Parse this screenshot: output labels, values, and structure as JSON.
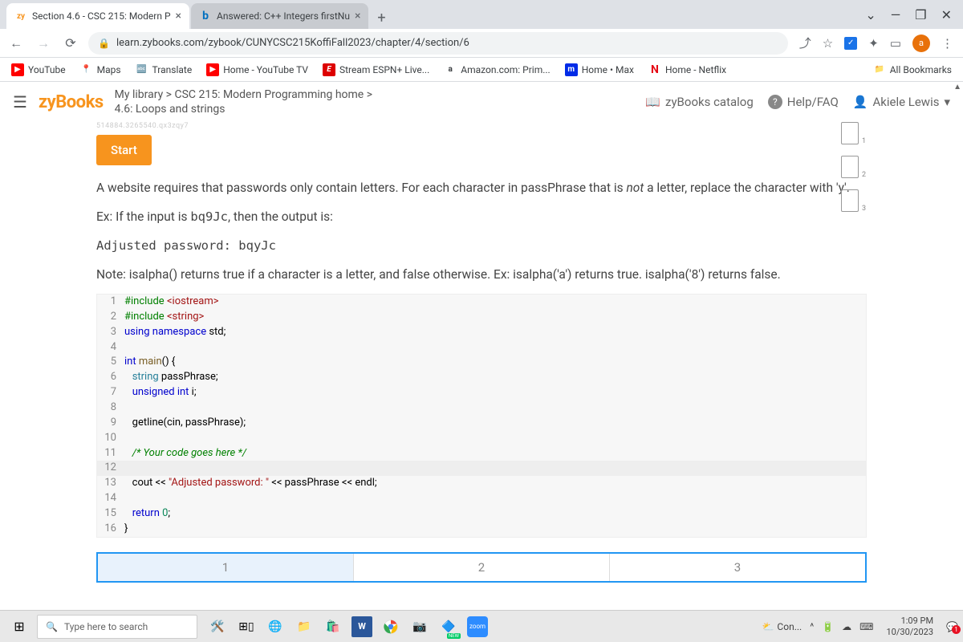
{
  "browser": {
    "tabs": [
      {
        "favicon_text": "zy",
        "favicon_color": "#f7941e",
        "title": "Section 4.6 - CSC 215: Modern P",
        "active": true
      },
      {
        "favicon_text": "b",
        "favicon_color": "#0070c0",
        "title": "Answered: C++ Integers firstNu",
        "active": false
      }
    ],
    "url": "learn.zybooks.com/zybook/CUNYCSC215KoffiFall2023/chapter/4/section/6",
    "bookmarks": [
      {
        "label": "YouTube",
        "icon": "▶",
        "icon_bg": "#ff0000",
        "icon_fg": "#fff"
      },
      {
        "label": "Maps",
        "icon": "📍",
        "icon_bg": "",
        "icon_fg": ""
      },
      {
        "label": "Translate",
        "icon": "🔤",
        "icon_bg": "",
        "icon_fg": ""
      },
      {
        "label": "Home - YouTube TV",
        "icon": "▶",
        "icon_bg": "#ff0000",
        "icon_fg": "#fff"
      },
      {
        "label": "Stream ESPN+ Live...",
        "icon": "E",
        "icon_bg": "#d00",
        "icon_fg": "#fff"
      },
      {
        "label": "Amazon.com: Prim...",
        "icon": "a",
        "icon_bg": "",
        "icon_fg": "#000"
      },
      {
        "label": "Home • Max",
        "icon": "m",
        "icon_bg": "#002be7",
        "icon_fg": "#fff"
      },
      {
        "label": "Home - Netflix",
        "icon": "N",
        "icon_bg": "",
        "icon_fg": "#e50914"
      }
    ],
    "all_bookmarks_label": "All Bookmarks",
    "avatar_letter": "a"
  },
  "zy": {
    "logo": "zyBooks",
    "breadcrumb_top": "My library > CSC 215: Modern Programming home >",
    "breadcrumb_bottom": "4.6: Loops and strings",
    "catalog": "zyBooks catalog",
    "help": "Help/FAQ",
    "user": "Akiele Lewis"
  },
  "activity": {
    "watermark": "514884.3265540.qx3zqy7",
    "start": "Start",
    "para1_a": "A website requires that passwords only contain letters. For each character in passPhrase that is ",
    "para1_em": "not",
    "para1_b": " a letter, replace the character with 'y'.",
    "ex_label": "Ex: If the input is ",
    "ex_input": "bq9Jc",
    "ex_tail": ", then the output is:",
    "ex_output": "Adjusted password: bqyJc",
    "note": "Note: isalpha() returns true if a character is a letter, and false otherwise. Ex: isalpha('a') returns true. isalpha('8') returns false.",
    "steps": [
      "1",
      "2",
      "3"
    ],
    "notebox_nums": [
      "1",
      "2",
      "3"
    ]
  },
  "code_lines": [
    {
      "n": 1,
      "html": "<span class='kw-green'>#include</span> <span class='kw-str'>&lt;iostream&gt;</span>"
    },
    {
      "n": 2,
      "html": "<span class='kw-green'>#include</span> <span class='kw-str'>&lt;string&gt;</span>"
    },
    {
      "n": 3,
      "html": "<span class='kw-blue'>using</span> <span class='kw-blue'>namespace</span> std;"
    },
    {
      "n": 4,
      "html": ""
    },
    {
      "n": 5,
      "html": "<span class='kw-blue'>int</span> <span class='kw-purple'>main</span>() {"
    },
    {
      "n": 6,
      "html": "   <span class='kw-teal'>string</span> passPhrase;"
    },
    {
      "n": 7,
      "html": "   <span class='kw-blue'>unsigned</span> <span class='kw-blue'>int</span> i;"
    },
    {
      "n": 8,
      "html": ""
    },
    {
      "n": 9,
      "html": "   getline(cin, passPhrase);"
    },
    {
      "n": 10,
      "html": ""
    },
    {
      "n": 11,
      "html": "   <span class='kw-comment'>/* Your code goes here */</span>"
    },
    {
      "n": 12,
      "html": "",
      "hl": true
    },
    {
      "n": 13,
      "html": "   cout &lt;&lt; <span class='kw-str'>\"Adjusted password: \"</span> &lt;&lt; passPhrase &lt;&lt; endl;"
    },
    {
      "n": 14,
      "html": ""
    },
    {
      "n": 15,
      "html": "   <span class='kw-blue'>return</span> <span class='kw-num'>0</span>;"
    },
    {
      "n": 16,
      "html": "}"
    }
  ],
  "taskbar": {
    "search_placeholder": "Type here to search",
    "weather_label": "Con...",
    "time": "1:09 PM",
    "date": "10/30/2023",
    "notif_count": "1"
  }
}
